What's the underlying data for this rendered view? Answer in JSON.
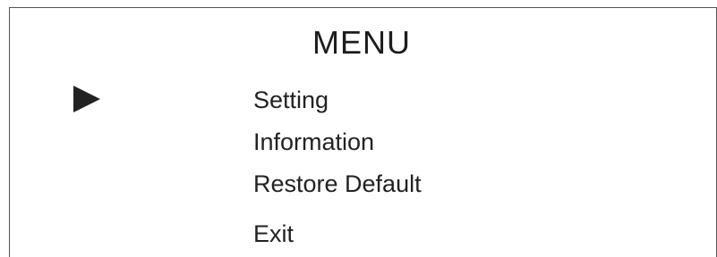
{
  "menu": {
    "title": "MENU",
    "selector_icon": "triangle-right-icon",
    "selected_index": 0,
    "items": [
      {
        "label": "Setting"
      },
      {
        "label": "Information"
      },
      {
        "label": "Restore Default"
      },
      {
        "label": "Exit"
      }
    ]
  },
  "colors": {
    "text": "#222222",
    "border": "#555555",
    "background": "#ffffff"
  }
}
